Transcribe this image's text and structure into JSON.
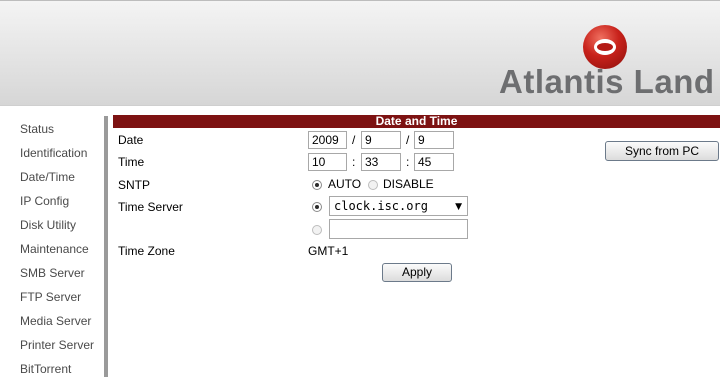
{
  "brand": {
    "logo_text": "Atlantis Land"
  },
  "sidebar": {
    "items": [
      {
        "label": "Status"
      },
      {
        "label": "Identification"
      },
      {
        "label": "Date/Time"
      },
      {
        "label": "IP Config"
      },
      {
        "label": "Disk Utility"
      },
      {
        "label": "Maintenance"
      },
      {
        "label": "SMB Server"
      },
      {
        "label": "FTP Server"
      },
      {
        "label": "Media Server"
      },
      {
        "label": "Printer Server"
      },
      {
        "label": "BitTorrent"
      }
    ]
  },
  "panel": {
    "title": "Date and Time",
    "labels": {
      "date": "Date",
      "time": "Time",
      "sntp": "SNTP",
      "time_server": "Time Server",
      "time_zone": "Time Zone"
    },
    "date": {
      "year": "2009",
      "month": "9",
      "day": "9",
      "sep": "/"
    },
    "time": {
      "hour": "10",
      "minute": "33",
      "second": "45",
      "sep": ":"
    },
    "sntp": {
      "auto_label": "AUTO",
      "disable_label": "DISABLE",
      "selected": "AUTO"
    },
    "time_server": {
      "selected": "clock.isc.org",
      "custom_value": ""
    },
    "time_zone": {
      "value": "GMT+1"
    },
    "apply_label": "Apply",
    "sync_label": "Sync from PC"
  },
  "colors": {
    "title_bar": "#7d1212",
    "logo_red": "#c8221b",
    "logo_text": "#6d6e70"
  }
}
